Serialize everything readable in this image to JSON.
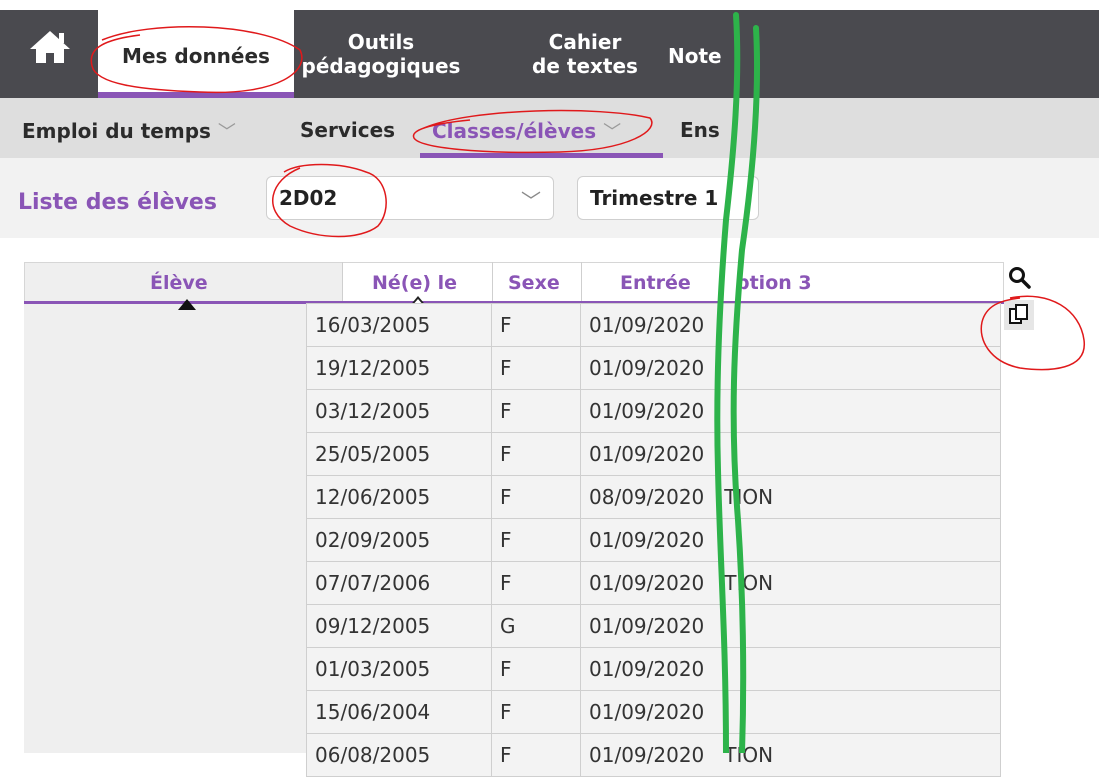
{
  "topnav": {
    "home_icon": "home-icon",
    "tabs": [
      {
        "label": "Mes données",
        "active": true
      },
      {
        "label_line1": "Outils",
        "label_line2": "pédagogiques"
      },
      {
        "label_line1": "Cahier",
        "label_line2": "de textes"
      },
      {
        "label": "Note"
      }
    ]
  },
  "subnav": {
    "items": [
      {
        "label": "Emploi du temps",
        "chevron": "chevron-down-icon"
      },
      {
        "label": "Services"
      },
      {
        "label": "Classes/élèves",
        "chevron": "chevron-down-icon",
        "active": true
      },
      {
        "label": "Ens"
      }
    ]
  },
  "toolbar": {
    "list_label": "Liste des élèves",
    "class_select": "2D02",
    "period_select": "Trimestre 1"
  },
  "grid": {
    "columns": [
      "Élève",
      "Né(e) le",
      "Sexe",
      "Entrée",
      "ption 3"
    ],
    "rows": [
      {
        "born": "16/03/2005",
        "sex": "F",
        "entry": "01/09/2020"
      },
      {
        "born": "19/12/2005",
        "sex": "F",
        "entry": "01/09/2020"
      },
      {
        "born": "03/12/2005",
        "sex": "F",
        "entry": "01/09/2020"
      },
      {
        "born": "25/05/2005",
        "sex": "F",
        "entry": "01/09/2020"
      },
      {
        "born": "12/06/2005",
        "sex": "F",
        "entry": "08/09/2020",
        "option": "TION"
      },
      {
        "born": "02/09/2005",
        "sex": "F",
        "entry": "01/09/2020"
      },
      {
        "born": "07/07/2006",
        "sex": "F",
        "entry": "01/09/2020",
        "option": "TION"
      },
      {
        "born": "09/12/2005",
        "sex": "G",
        "entry": "01/09/2020"
      },
      {
        "born": "01/03/2005",
        "sex": "F",
        "entry": "01/09/2020"
      },
      {
        "born": "15/06/2004",
        "sex": "F",
        "entry": "01/09/2020"
      },
      {
        "born": "06/08/2005",
        "sex": "F",
        "entry": "01/09/2020",
        "option": "TION"
      }
    ]
  },
  "side_icons": [
    "search-icon",
    "copy-icon"
  ],
  "colors": {
    "accent": "#8a55b6",
    "topbar": "#4a4a4f",
    "annotation_red": "#e0191b",
    "annotation_green": "#2db34a"
  }
}
